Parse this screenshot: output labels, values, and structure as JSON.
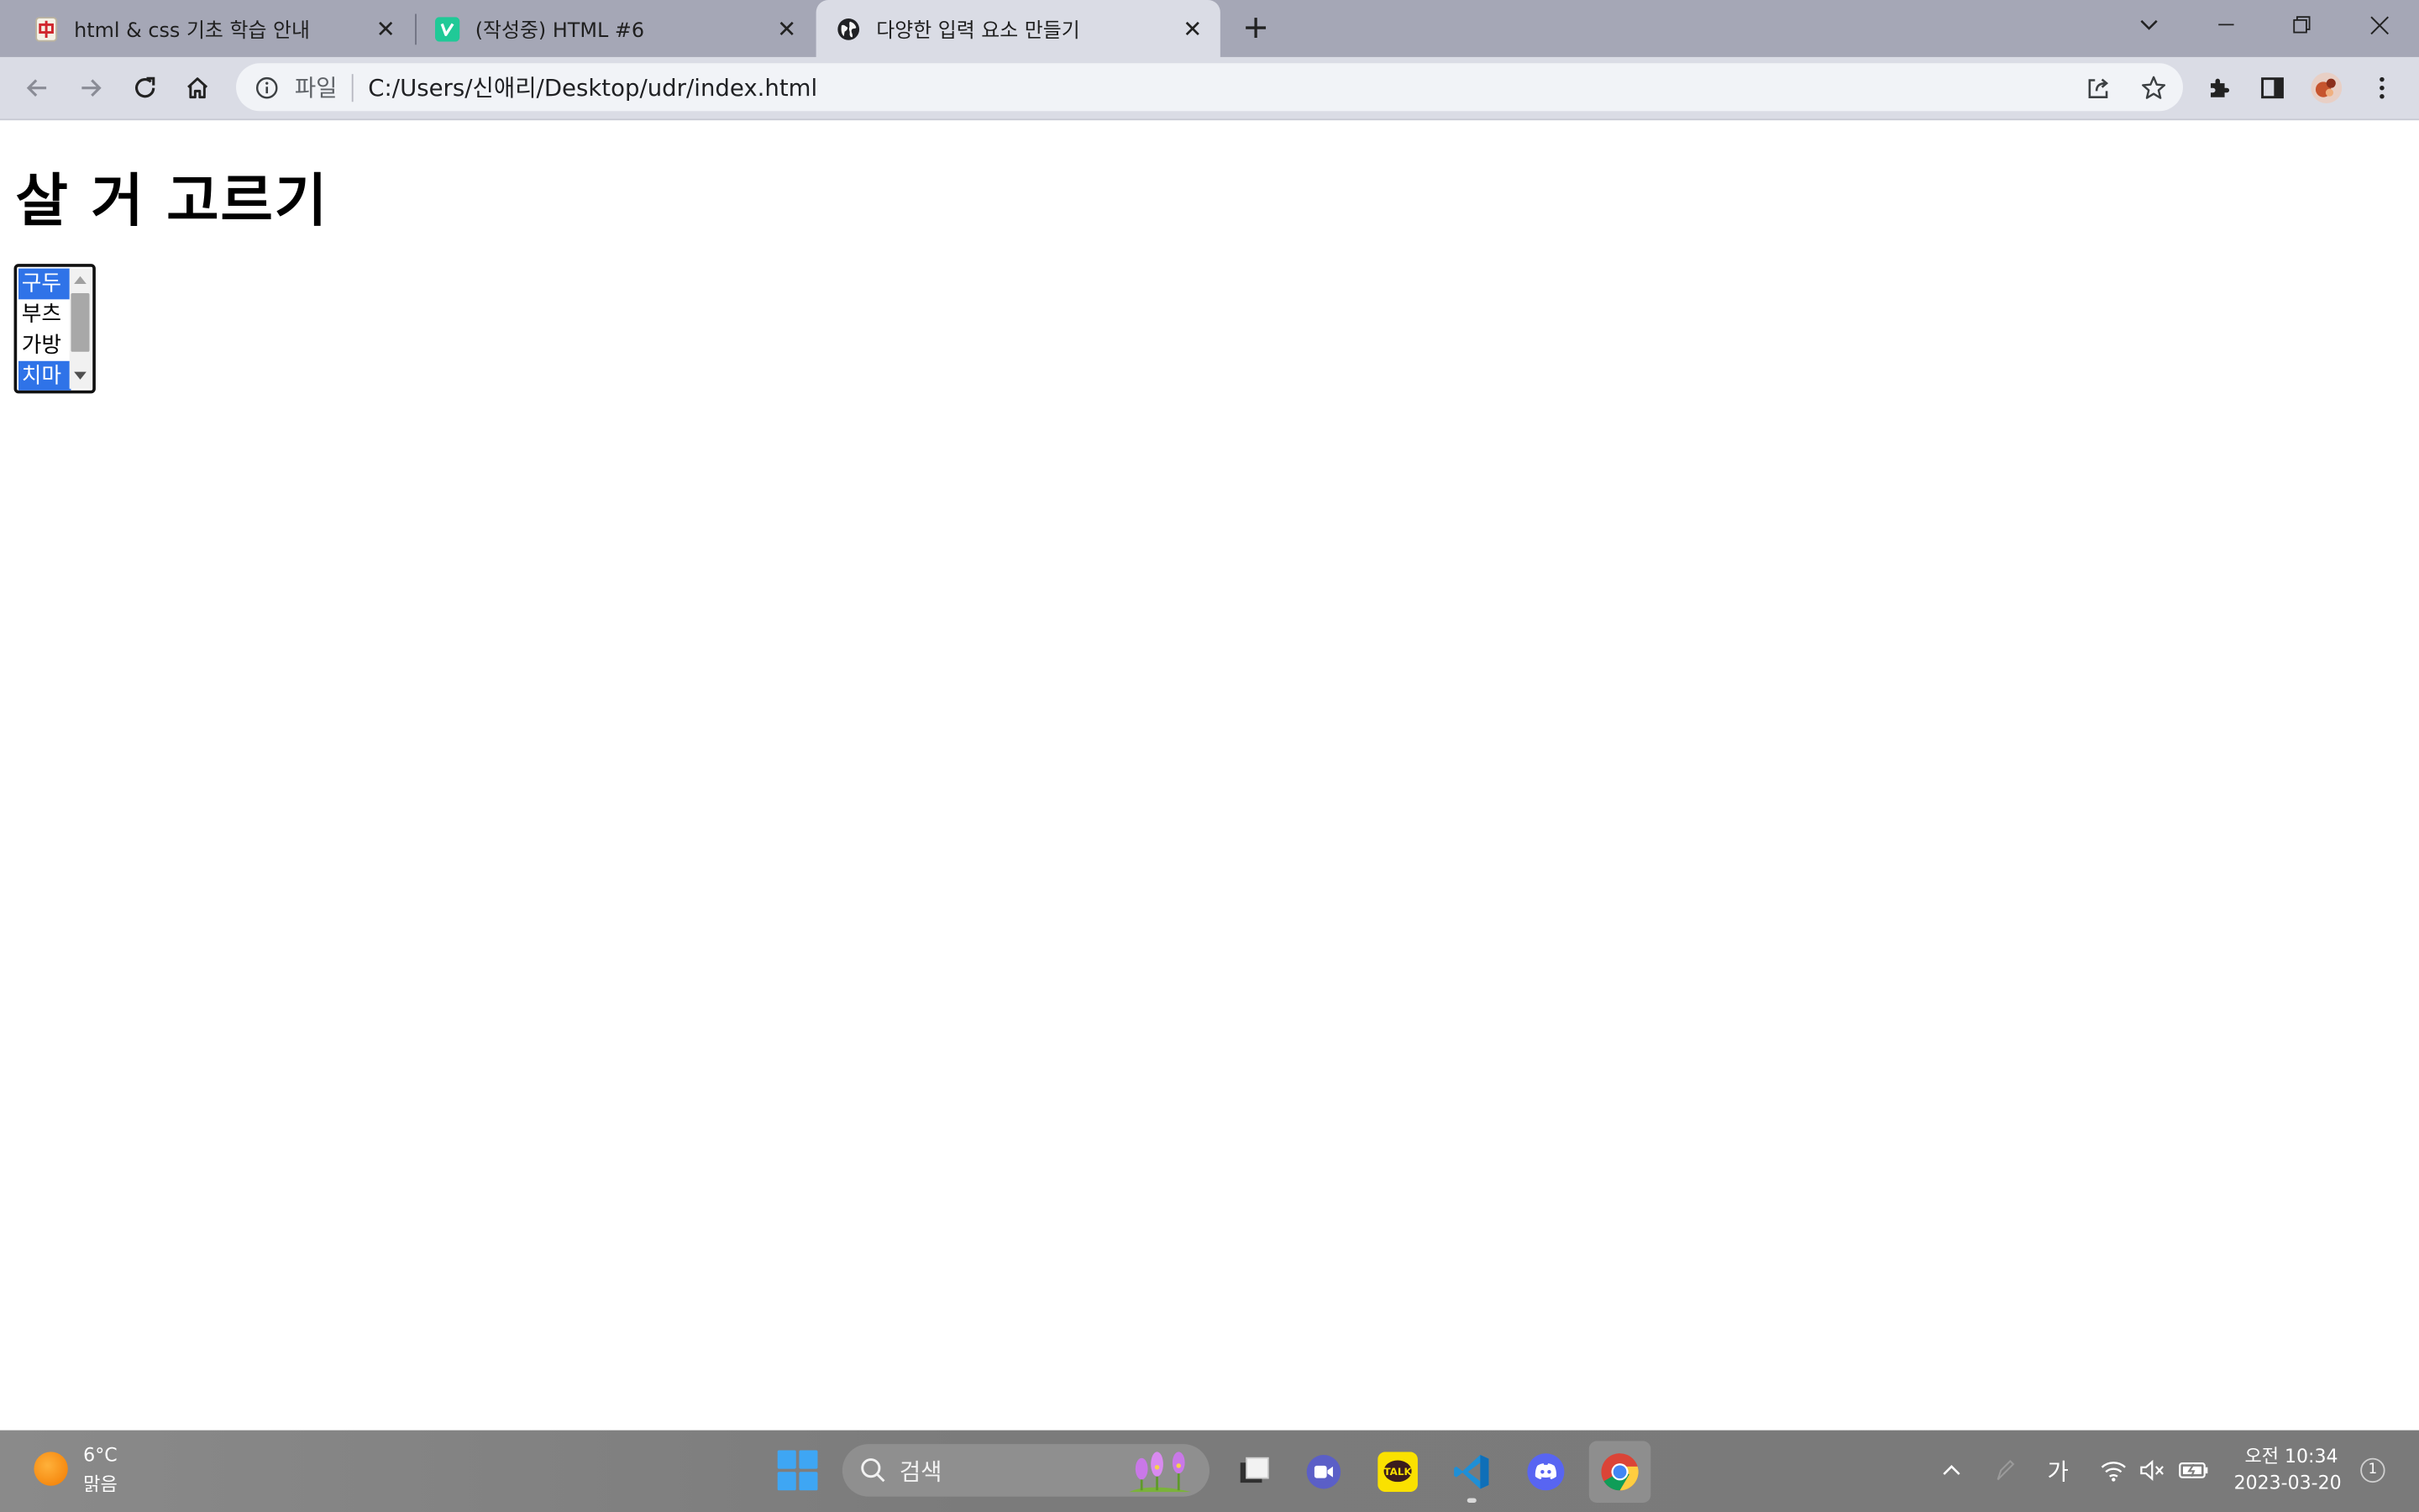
{
  "browser": {
    "tabs": [
      {
        "title": "html & css 기초 학습 안내",
        "favicon": "mahjong-zhong-icon",
        "active": false
      },
      {
        "title": "(작성중) HTML #6",
        "favicon": "velog-v-icon",
        "active": false
      },
      {
        "title": "다양한 입력 요소 만들기",
        "favicon": "globe-icon",
        "active": true
      }
    ],
    "omnibox": {
      "scheme_label": "파일",
      "url": "C:/Users/신애리/Desktop/udr/index.html"
    }
  },
  "page": {
    "heading": "살 거 고르기",
    "listbox": {
      "options": [
        {
          "label": "구두",
          "selected": true
        },
        {
          "label": "부츠",
          "selected": false
        },
        {
          "label": "가방",
          "selected": false
        },
        {
          "label": "치마",
          "selected": true
        }
      ]
    }
  },
  "taskbar": {
    "weather": {
      "temp": "6°C",
      "condition": "맑음"
    },
    "search_label": "검색",
    "ime_label": "가",
    "clock": {
      "time": "오전 10:34",
      "date": "2023-03-20"
    },
    "notification_count": "1"
  },
  "colors": {
    "tabstrip_bg": "#a5a7b6",
    "toolbar_bg": "#dadce5",
    "selection_blue": "#2f73e8",
    "taskbar_bg": "#7d7d7d"
  }
}
